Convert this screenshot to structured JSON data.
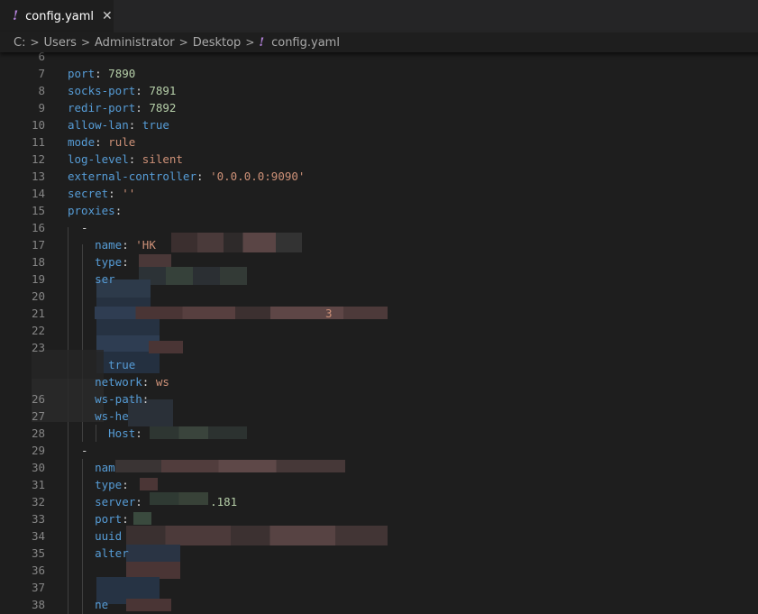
{
  "tab": {
    "title": "config.yaml",
    "close_glyph": "✕",
    "warn_glyph": "!"
  },
  "breadcrumb": {
    "items": [
      "C:",
      "Users",
      "Administrator",
      "Desktop"
    ],
    "file": "config.yaml",
    "warn_glyph": "!",
    "sep_glyph": ">"
  },
  "lines": [
    {
      "n": "6",
      "code": []
    },
    {
      "n": "7",
      "code": [
        [
          "k",
          "port"
        ],
        [
          "p",
          ": "
        ],
        [
          "n",
          "7890"
        ]
      ]
    },
    {
      "n": "8",
      "code": [
        [
          "k",
          "socks-port"
        ],
        [
          "p",
          ": "
        ],
        [
          "n",
          "7891"
        ]
      ]
    },
    {
      "n": "9",
      "code": [
        [
          "k",
          "redir-port"
        ],
        [
          "p",
          ": "
        ],
        [
          "n",
          "7892"
        ]
      ]
    },
    {
      "n": "10",
      "code": [
        [
          "k",
          "allow-lan"
        ],
        [
          "p",
          ": "
        ],
        [
          "k",
          "true"
        ]
      ]
    },
    {
      "n": "11",
      "code": [
        [
          "k",
          "mode"
        ],
        [
          "p",
          ": "
        ],
        [
          "s",
          "rule"
        ]
      ]
    },
    {
      "n": "12",
      "code": [
        [
          "k",
          "log-level"
        ],
        [
          "p",
          ": "
        ],
        [
          "s",
          "silent"
        ]
      ]
    },
    {
      "n": "13",
      "code": [
        [
          "k",
          "external-controller"
        ],
        [
          "p",
          ": "
        ],
        [
          "s",
          "'0.0.0.0:9090'"
        ]
      ]
    },
    {
      "n": "14",
      "code": [
        [
          "k",
          "secret"
        ],
        [
          "p",
          ": "
        ],
        [
          "s",
          "''"
        ]
      ]
    },
    {
      "n": "15",
      "code": [
        [
          "k",
          "proxies"
        ],
        [
          "p",
          ":"
        ]
      ]
    },
    {
      "n": "16",
      "code": [
        [
          "p",
          "  -"
        ]
      ]
    },
    {
      "n": "17",
      "code": [
        [
          "p",
          "    "
        ],
        [
          "k",
          "name"
        ],
        [
          "p",
          ": "
        ],
        [
          "s",
          "'HK"
        ]
      ]
    },
    {
      "n": "18",
      "code": [
        [
          "p",
          "    "
        ],
        [
          "k",
          "type"
        ],
        [
          "p",
          ":"
        ]
      ]
    },
    {
      "n": "19",
      "code": [
        [
          "p",
          "    "
        ],
        [
          "k",
          "ser"
        ]
      ]
    },
    {
      "n": "20",
      "code": []
    },
    {
      "n": "21",
      "code": [
        [
          "p",
          "                                      "
        ],
        [
          "s",
          "3"
        ]
      ]
    },
    {
      "n": "22",
      "code": []
    },
    {
      "n": "23",
      "code": []
    },
    {
      "n": "",
      "code": [
        [
          "p",
          "      "
        ],
        [
          "k",
          "true"
        ]
      ]
    },
    {
      "n": "",
      "code": [
        [
          "p",
          "    "
        ],
        [
          "k",
          "network"
        ],
        [
          "p",
          ": "
        ],
        [
          "s",
          "ws"
        ]
      ]
    },
    {
      "n": "26",
      "code": [
        [
          "p",
          "    "
        ],
        [
          "k",
          "ws-path"
        ],
        [
          "p",
          ":"
        ]
      ]
    },
    {
      "n": "27",
      "code": [
        [
          "p",
          "    "
        ],
        [
          "k",
          "ws-he"
        ]
      ]
    },
    {
      "n": "28",
      "code": [
        [
          "p",
          "      "
        ],
        [
          "k",
          "Host"
        ],
        [
          "p",
          ":"
        ]
      ]
    },
    {
      "n": "29",
      "code": [
        [
          "p",
          "  -"
        ]
      ]
    },
    {
      "n": "30",
      "code": [
        [
          "p",
          "    "
        ],
        [
          "k",
          "nam"
        ]
      ]
    },
    {
      "n": "31",
      "code": [
        [
          "p",
          "    "
        ],
        [
          "k",
          "type"
        ],
        [
          "p",
          ":"
        ]
      ]
    },
    {
      "n": "32",
      "code": [
        [
          "p",
          "    "
        ],
        [
          "k",
          "server"
        ],
        [
          "p",
          ":          "
        ],
        [
          "n",
          ".181"
        ]
      ]
    },
    {
      "n": "33",
      "code": [
        [
          "p",
          "    "
        ],
        [
          "k",
          "port"
        ],
        [
          "p",
          ":"
        ]
      ]
    },
    {
      "n": "34",
      "code": [
        [
          "p",
          "    "
        ],
        [
          "k",
          "uuid"
        ]
      ]
    },
    {
      "n": "35",
      "code": [
        [
          "p",
          "    "
        ],
        [
          "k",
          "alter"
        ]
      ]
    },
    {
      "n": "36",
      "code": []
    },
    {
      "n": "37",
      "code": []
    },
    {
      "n": "38",
      "code": [
        [
          "p",
          "    "
        ],
        [
          "k",
          "ne"
        ]
      ]
    }
  ]
}
